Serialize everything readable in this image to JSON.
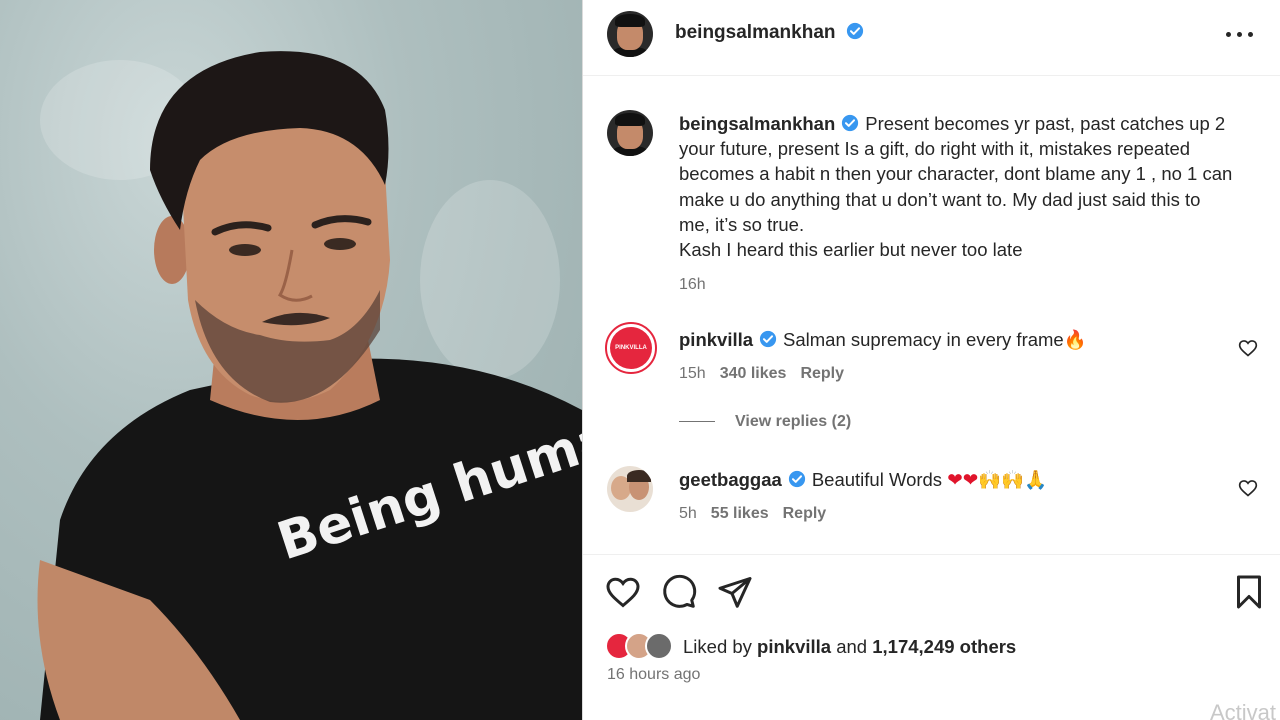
{
  "photo": {
    "shirt_text": "Being human"
  },
  "post": {
    "username": "beingsalmankhan",
    "caption_lines": [
      "Present becomes yr past, past catches up 2",
      "your future, present Is a gift, do right with it, mistakes repeated",
      "becomes a habit n then your character, dont blame any 1 , no 1 can",
      "make u do anything that u don’t want to. My dad just said this to",
      "me, it’s so true.",
      "Kash I heard this earlier but never too late"
    ],
    "caption_age": "16h"
  },
  "comments": [
    {
      "username": "pinkvilla",
      "avatar_text": "PINKVILLA",
      "text": "Salman supremacy in every frame",
      "emoji": "🔥",
      "age": "15h",
      "likes": "340 likes",
      "reply": "Reply"
    },
    {
      "username": "geetbaggaa",
      "text": "Beautiful Words",
      "emoji": "❤❤🙌🙌🙏",
      "age": "5h",
      "likes": "55 likes",
      "reply": "Reply"
    }
  ],
  "view_replies": "View replies (2)",
  "likes": {
    "prefix": "Liked by",
    "user": "pinkvilla",
    "and": "and",
    "count": "1,174,249 others"
  },
  "timestamp": "16 hours ago",
  "watermark": "Activat",
  "colors": {
    "verified": "#3897f0",
    "pinkvilla": "#e5263e",
    "muted": "#737373"
  },
  "icons": [
    "more-options-icon",
    "verified-icon",
    "heart-icon",
    "comment-icon",
    "share-icon",
    "save-icon"
  ]
}
